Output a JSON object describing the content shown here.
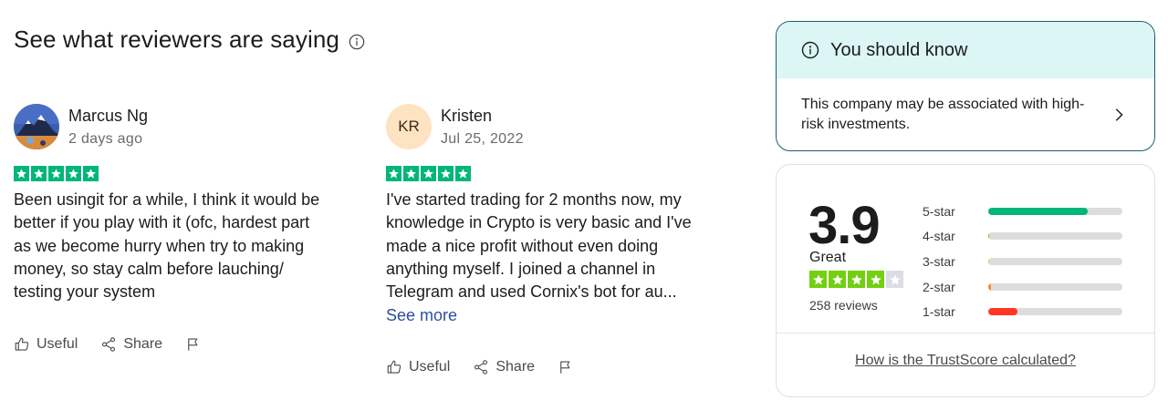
{
  "section_title": "See what reviewers are saying",
  "reviews": [
    {
      "name": "Marcus Ng",
      "date": "2 days ago",
      "rating": 5,
      "text": "Been usingit for a while, I think it would be better if you play with it (ofc, hardest part as we become hurry when try to making money, so stay calm before lauching/ testing your system",
      "see_more": "",
      "avatar_type": "photo"
    },
    {
      "name": "Kristen",
      "initials": "KR",
      "date": "Jul 25, 2022",
      "rating": 5,
      "text": "I've started trading for 2 months now, my knowledge in Crypto is very basic and I've made a nice profit without even doing anything myself. I joined a channel in Telegram and used Cornix's bot for au...",
      "see_more": "See more",
      "avatar_type": "initials"
    }
  ],
  "actions": {
    "useful": "Useful",
    "share": "Share"
  },
  "notice": {
    "title": "You should know",
    "message": "This company may be associated with high-risk investments."
  },
  "trustscore": {
    "score": "3.9",
    "label": "Great",
    "stars": 4,
    "review_count": "258 reviews",
    "distribution": [
      {
        "label": "5-star",
        "fraction": 0.74,
        "color": "#00b67a"
      },
      {
        "label": "4-star",
        "fraction": 0.01,
        "color": "#73cf11"
      },
      {
        "label": "3-star",
        "fraction": 0.01,
        "color": "#ffce00"
      },
      {
        "label": "2-star",
        "fraction": 0.02,
        "color": "#ff8622"
      },
      {
        "label": "1-star",
        "fraction": 0.22,
        "color": "#ff3722"
      }
    ],
    "how_calculated": "How is the TrustScore calculated?"
  },
  "colors": {
    "review_star": "#00b67a",
    "score_star": "#73cf11",
    "link": "#2b4fa0",
    "notice_bg": "#dcf5f5",
    "notice_border": "#1c5d6b"
  },
  "icons": [
    "info-icon",
    "thumbs-up-icon",
    "share-icon",
    "flag-icon",
    "chevron-right-icon",
    "star-icon"
  ]
}
